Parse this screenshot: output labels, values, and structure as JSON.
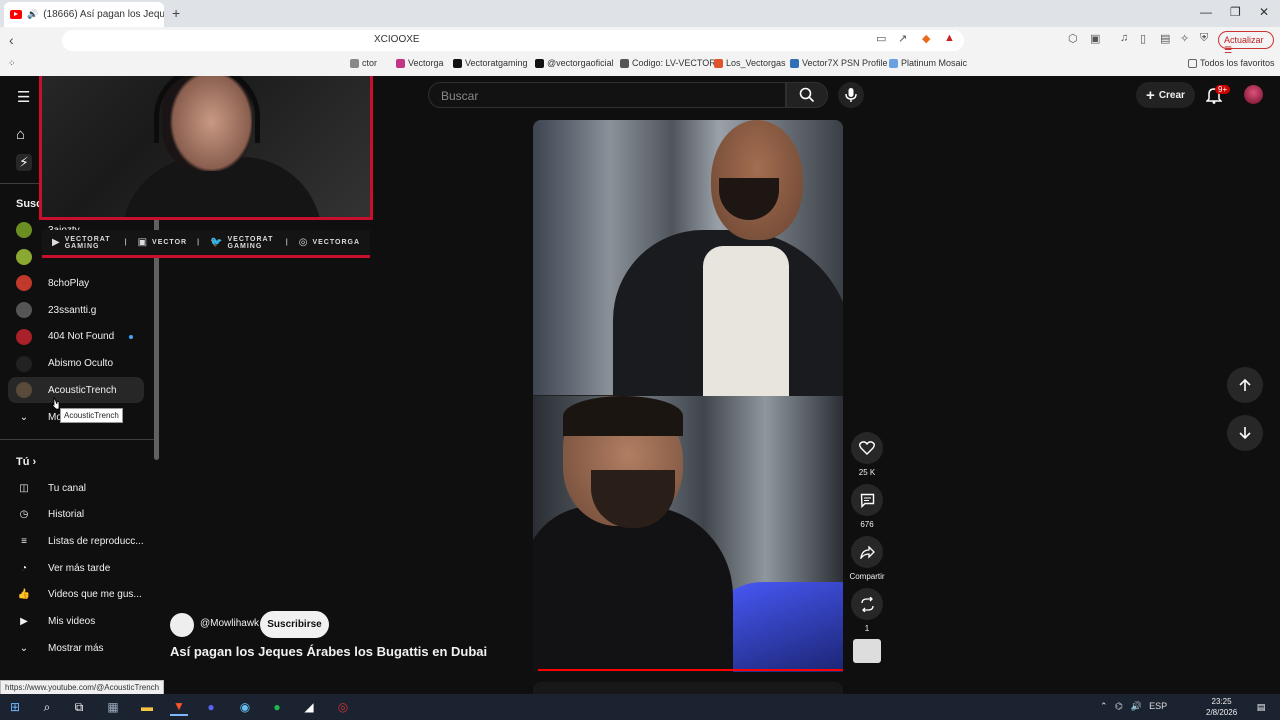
{
  "browser": {
    "tab_title": "(18666) Así pagan los Jeques",
    "url": "XCIOOXE",
    "update_label": "Actualizar",
    "bookmarks": [
      {
        "label": "ctor",
        "color": "#888888"
      },
      {
        "label": "Vectorga",
        "color": "#c13584"
      },
      {
        "label": "Vectoratgaming",
        "color": "#111111"
      },
      {
        "label": "@vectorgaoficial",
        "color": "#111111"
      },
      {
        "label": "Codigo: LV-VECTOR",
        "color": "#555555"
      },
      {
        "label": "Los_Vectorgas",
        "color": "#e0532d"
      },
      {
        "label": "Vector7X PSN Profile",
        "color": "#2f6fb5"
      },
      {
        "label": "Platinum Mosaic",
        "color": "#6aa0e0"
      }
    ],
    "favorites_label": "Todos los favoritos",
    "status_url": "https://www.youtube.com/@AcousticTrench"
  },
  "youtube": {
    "search_placeholder": "Buscar",
    "create_label": "Crear",
    "notif_count": "9+",
    "subscriptions_heading": "Susc",
    "channels": [
      {
        "name": "3aiozty",
        "color": "#6b8e23",
        "dot": false
      },
      {
        "name": "",
        "color": "#8aa832",
        "dot": false
      },
      {
        "name": "8choPlay",
        "color": "#c0392b",
        "dot": false
      },
      {
        "name": "23ssantti.g",
        "color": "#555555",
        "dot": false
      },
      {
        "name": "404 Not Found",
        "color": "#a8202a",
        "dot": true
      },
      {
        "name": "Abismo Oculto",
        "color": "#222222",
        "dot": false
      },
      {
        "name": "AcousticTrench",
        "color": "#5a4a3a",
        "dot": false
      }
    ],
    "show_more_partial": "Mo",
    "tooltip": "AcousticTrench",
    "you_heading": "Tú",
    "you_items": [
      {
        "label": "Tu canal",
        "icon": "channel-icon"
      },
      {
        "label": "Historial",
        "icon": "history-icon"
      },
      {
        "label": "Listas de reproducc...",
        "icon": "playlists-icon"
      },
      {
        "label": "Ver más tarde",
        "icon": "watch-later-icon"
      },
      {
        "label": "Videos que me gus...",
        "icon": "like-icon"
      },
      {
        "label": "Mis videos",
        "icon": "my-videos-icon"
      },
      {
        "label": "Mostrar más",
        "icon": "chevron-down-icon"
      }
    ],
    "short": {
      "channel_handle": "@Mowlihawk",
      "subscribe_label": "Suscribirse",
      "title": "Así pagan los Jeques Árabes los Bugattis en Dubai",
      "likes": "25 K",
      "comments": "676",
      "share_label": "Compartir",
      "remix_count": "1",
      "progress": 1.0
    }
  },
  "overlay": {
    "social": [
      {
        "icon": "youtube-icon",
        "text": "VECTORAT GAMING"
      },
      {
        "icon": "twitch-icon",
        "text": "VECTOR"
      },
      {
        "icon": "twitter-icon",
        "text": "VECTORAT GAMING"
      },
      {
        "icon": "instagram-icon",
        "text": "VECTORGA"
      }
    ]
  },
  "taskbar": {
    "lang": "ESP",
    "time": "23:25",
    "date": "2/8/2026",
    "notif": "18"
  }
}
